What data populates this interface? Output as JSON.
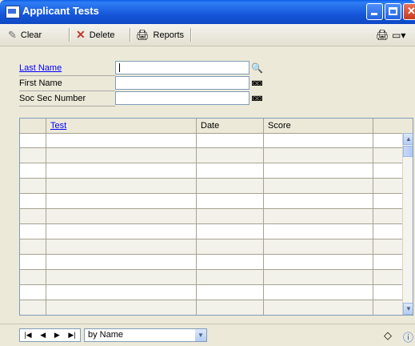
{
  "window": {
    "title": "Applicant Tests"
  },
  "toolbar": {
    "clear_label": "Clear",
    "delete_label": "Delete",
    "reports_label": "Reports"
  },
  "form": {
    "last_name_label": "Last Name",
    "last_name_value": "",
    "first_name_label": "First Name",
    "first_name_value": "",
    "ssn_label": "Soc Sec Number",
    "ssn_value": ""
  },
  "grid": {
    "columns": [
      "",
      "Test",
      "Date",
      "Score",
      ""
    ],
    "row_count": 12
  },
  "statusbar": {
    "sort_value": "by Name"
  },
  "colors": {
    "title_bar": "#1656d9",
    "window_bg": "#ece9d8",
    "link": "#0000ff"
  }
}
